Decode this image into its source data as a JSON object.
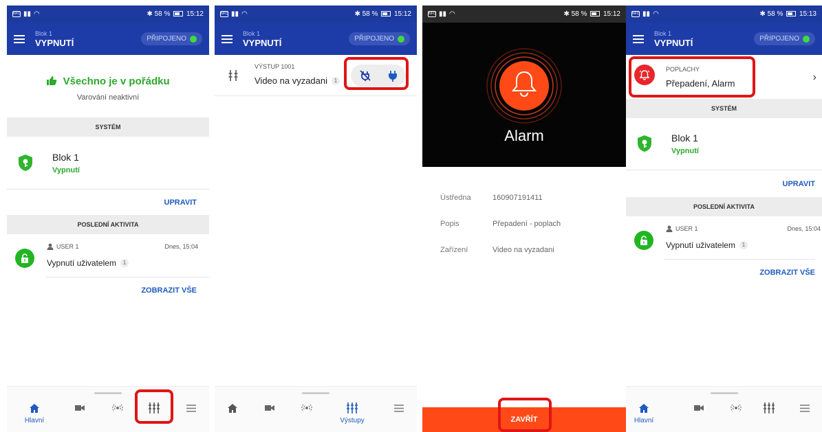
{
  "status_bar": {
    "battery_1": "58 %",
    "time_1": "15:12",
    "battery_2": "58 %",
    "time_2": "15:12",
    "battery_3": "58 %",
    "time_3": "15:12",
    "battery_4": "58 %",
    "time_4": "15:13"
  },
  "app_bar": {
    "subtitle": "Blok 1",
    "title": "VYPNUTÍ",
    "connection": "PŘIPOJENO",
    "connection_color": "#3ddc3d"
  },
  "home": {
    "status_title": "Všechno je v pořádku",
    "status_sub": "Varování neaktivní",
    "system_header": "SYSTÉM",
    "system_name": "Blok 1",
    "system_state": "Vypnutí",
    "edit_label": "UPRAVIT",
    "activity_header": "POSLEDNÍ AKTIVITA",
    "activity_user": "USER 1",
    "activity_time": "Dnes, 15:04",
    "activity_text": "Vypnutí uživatelem",
    "activity_badge": "1",
    "show_all": "ZOBRAZIT VŠE"
  },
  "outputs": {
    "label": "VÝSTUP 1001",
    "name": "Video na vyzadani",
    "badge": "1"
  },
  "alarm": {
    "title": "Alarm",
    "rows": [
      {
        "key": "Ústředna",
        "value": "160907191411"
      },
      {
        "key": "Popis",
        "value": "Přepadení - poplach"
      },
      {
        "key": "Zařízení",
        "value": "Video na vyzadani"
      }
    ],
    "close_label": "ZAVŘÍT",
    "accent_color": "#ff4a17"
  },
  "alarms_card": {
    "label": "POPLACHY",
    "value": "Přepadení, Alarm"
  },
  "nav": {
    "home_label": "Hlavní",
    "outputs_label": "Výstupy"
  },
  "icons": [
    "hamburger-icon",
    "thumbs-up-icon",
    "shield-key-icon",
    "lock-icon",
    "user-icon",
    "home-icon",
    "camera-icon",
    "detector-icon",
    "outputs-icon",
    "list-icon",
    "bell-icon",
    "plug-off-icon",
    "plug-on-icon",
    "chevron-right-icon"
  ],
  "colors": {
    "app_bar": "#1e3ca8",
    "ok_green": "#2ea82e",
    "link_blue": "#1e5bbf",
    "highlight_red": "#e01515"
  }
}
